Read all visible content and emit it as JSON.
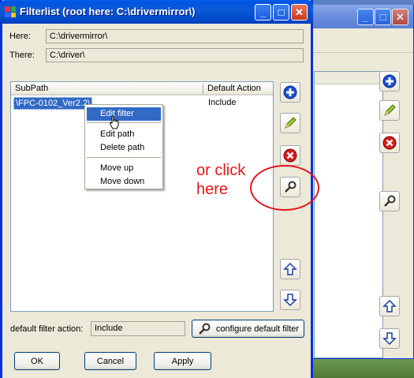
{
  "window": {
    "title": "Filterlist (root here: C:\\drivermirror\\)",
    "caption": {
      "minimize": "_",
      "maximize": "□",
      "close": "✕"
    }
  },
  "fields": {
    "here_label": "Here:",
    "here_value": "C:\\drivermirror\\",
    "there_label": "There:",
    "there_value": "C:\\driver\\"
  },
  "list": {
    "columns": [
      "SubPath",
      "Default Action"
    ],
    "rows": [
      {
        "subpath": "\\FPC-0102_Ver2.2\\",
        "action": "Include"
      }
    ]
  },
  "context_menu": {
    "items": [
      "Edit filter",
      "Edit path",
      "Delete path",
      "Move up",
      "Move down"
    ],
    "selected": "Edit filter"
  },
  "toolbar_icons": [
    "add-icon",
    "edit-pencil-icon",
    "delete-icon",
    "wrench-icon",
    "move-up-icon",
    "move-down-icon"
  ],
  "default_filter": {
    "label": "default filter action:",
    "value": "Include",
    "configure_button": "configure default filter"
  },
  "buttons": {
    "ok": "OK",
    "cancel": "Cancel",
    "apply": "Apply"
  },
  "annotation": {
    "line1": "or click",
    "line2": "here",
    "color": "#e4161b"
  },
  "colors": {
    "titlebar": "#0054e3",
    "selection": "#316ac5",
    "dialog_bg": "#ece9d8"
  }
}
